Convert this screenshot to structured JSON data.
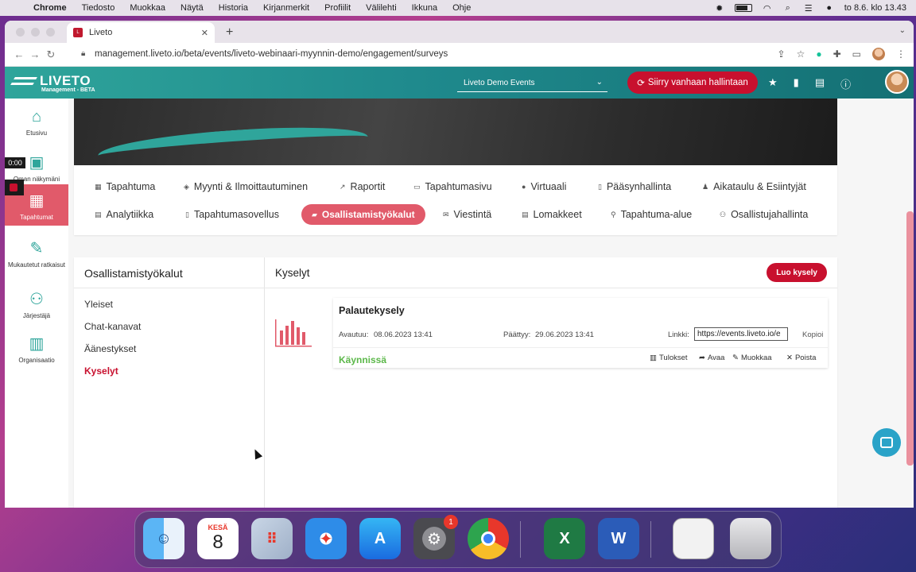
{
  "menubar": {
    "app": "Chrome",
    "items": [
      "Tiedosto",
      "Muokkaa",
      "Näytä",
      "Historia",
      "Kirjanmerkit",
      "Profiilit",
      "Välilehti",
      "Ikkuna",
      "Ohje"
    ],
    "clock": "to 8.6. klo 13.43"
  },
  "browser": {
    "tab_title": "Liveto",
    "url": "management.liveto.io/beta/events/liveto-webinaari-myynnin-demo/engagement/surveys"
  },
  "header": {
    "brand": "LIVETO",
    "brand_sub": "Management - BETA",
    "org_select": "Liveto Demo Events",
    "legacy_button": "Siirry vanhaan hallintaan"
  },
  "sidebar": {
    "items": [
      {
        "label": "Etusivu",
        "icon": "home-icon"
      },
      {
        "label": "Oman näkymäni",
        "icon": "layout-icon"
      },
      {
        "label": "Tapahtumat",
        "icon": "calendar-icon"
      },
      {
        "label": "Mukautetut ratkaisut",
        "icon": "edit-icon"
      },
      {
        "label": "Järjestäjä",
        "icon": "users-icon"
      },
      {
        "label": "Organisaatio",
        "icon": "building-icon"
      }
    ],
    "recording_time": "0:00"
  },
  "event_nav": {
    "row1": [
      "Tapahtuma",
      "Myynti & Ilmoittautuminen",
      "Raportit",
      "Tapahtumasivu",
      "Virtuaali",
      "Pääsynhallinta",
      "Aikataulu & Esiintyjät"
    ],
    "row2": [
      "Analytiikka",
      "Tapahtumasovellus",
      "Osallistamistyökalut",
      "Viestintä",
      "Lomakkeet",
      "Tapahtuma-alue",
      "Osallistujahallinta"
    ]
  },
  "engagement": {
    "title": "Osallistamistyökalut",
    "menu": [
      "Yleiset",
      "Chat-kanavat",
      "Äänestykset",
      "Kyselyt"
    ],
    "section_title": "Kyselyt",
    "create_button": "Luo kysely",
    "survey": {
      "name": "Palautekysely",
      "opened_label": "Avautuu:",
      "opened": "08.06.2023 13:41",
      "ends_label": "Päättyy:",
      "ends": "29.06.2023 13:41",
      "link_label": "Linkki:",
      "link": "https://events.liveto.io/e",
      "copy": "Kopioi",
      "status": "Käynnissä",
      "actions": [
        "Tulokset",
        "Avaa",
        "Muokkaa",
        "Poista"
      ]
    }
  },
  "dock": {
    "calendar_month": "KESÄ",
    "calendar_day": "8",
    "settings_badge": "1"
  },
  "colors": {
    "brand_teal": "#1f8a8d",
    "accent_red": "#c8102e",
    "active_pink": "#e15a6a",
    "status_green": "#5cb84a"
  }
}
